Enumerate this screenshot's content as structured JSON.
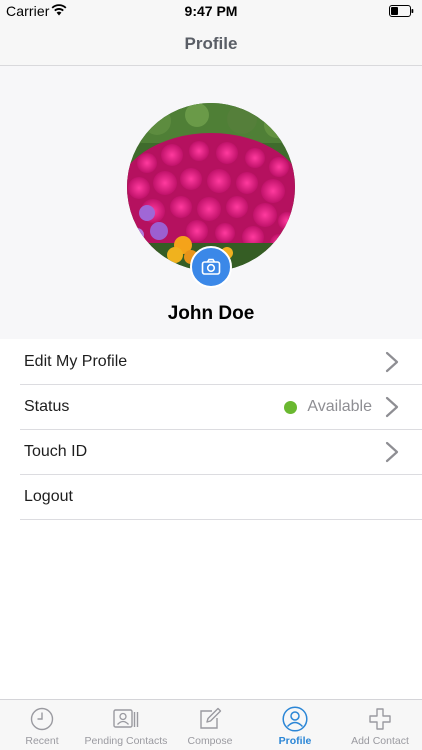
{
  "status_bar": {
    "carrier": "Carrier",
    "time": "9:47 PM"
  },
  "header": {
    "title": "Profile"
  },
  "profile": {
    "name": "John Doe",
    "avatar": "flower-photo",
    "camera_icon": "camera-icon"
  },
  "menu": {
    "items": [
      {
        "label": "Edit My Profile",
        "icon": "chevron-right-icon"
      },
      {
        "label": "Status",
        "value": "Available",
        "status_color": "#6ab830",
        "icon": "chevron-right-icon"
      },
      {
        "label": "Touch ID",
        "icon": "chevron-right-icon"
      },
      {
        "label": "Logout"
      }
    ]
  },
  "tabs": [
    {
      "label": "Recent",
      "icon": "clock-icon",
      "active": false
    },
    {
      "label": "Pending Contacts",
      "icon": "contact-card-icon",
      "active": false
    },
    {
      "label": "Compose",
      "icon": "compose-icon",
      "active": false
    },
    {
      "label": "Profile",
      "icon": "person-icon",
      "active": true
    },
    {
      "label": "Add Contact",
      "icon": "plus-icon",
      "active": false
    }
  ],
  "colors": {
    "accent": "#3b88e8",
    "active_tab": "#2b86d6",
    "status_available": "#6ab830"
  }
}
